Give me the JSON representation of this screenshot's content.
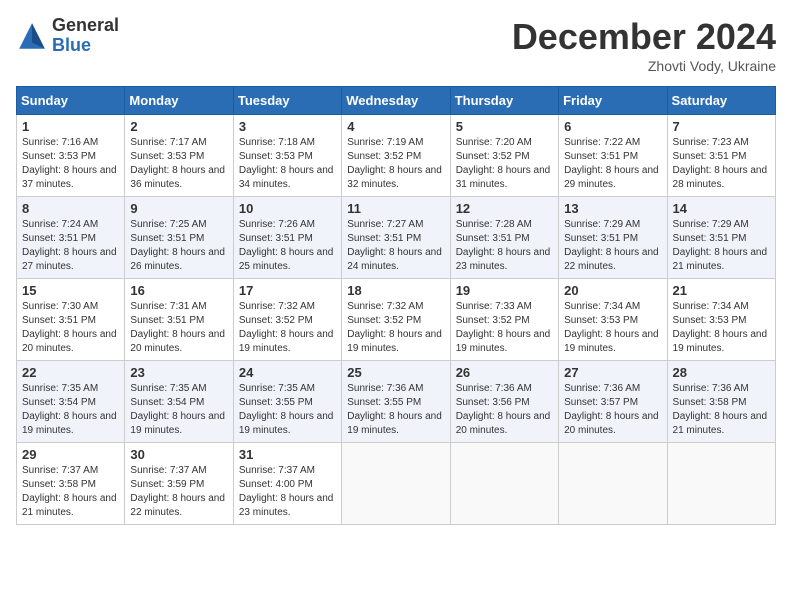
{
  "logo": {
    "general": "General",
    "blue": "Blue"
  },
  "title": "December 2024",
  "location": "Zhovti Vody, Ukraine",
  "days_of_week": [
    "Sunday",
    "Monday",
    "Tuesday",
    "Wednesday",
    "Thursday",
    "Friday",
    "Saturday"
  ],
  "weeks": [
    [
      {
        "day": "1",
        "sunrise": "7:16 AM",
        "sunset": "3:53 PM",
        "daylight": "8 hours and 37 minutes."
      },
      {
        "day": "2",
        "sunrise": "7:17 AM",
        "sunset": "3:53 PM",
        "daylight": "8 hours and 36 minutes."
      },
      {
        "day": "3",
        "sunrise": "7:18 AM",
        "sunset": "3:53 PM",
        "daylight": "8 hours and 34 minutes."
      },
      {
        "day": "4",
        "sunrise": "7:19 AM",
        "sunset": "3:52 PM",
        "daylight": "8 hours and 32 minutes."
      },
      {
        "day": "5",
        "sunrise": "7:20 AM",
        "sunset": "3:52 PM",
        "daylight": "8 hours and 31 minutes."
      },
      {
        "day": "6",
        "sunrise": "7:22 AM",
        "sunset": "3:51 PM",
        "daylight": "8 hours and 29 minutes."
      },
      {
        "day": "7",
        "sunrise": "7:23 AM",
        "sunset": "3:51 PM",
        "daylight": "8 hours and 28 minutes."
      }
    ],
    [
      {
        "day": "8",
        "sunrise": "7:24 AM",
        "sunset": "3:51 PM",
        "daylight": "8 hours and 27 minutes."
      },
      {
        "day": "9",
        "sunrise": "7:25 AM",
        "sunset": "3:51 PM",
        "daylight": "8 hours and 26 minutes."
      },
      {
        "day": "10",
        "sunrise": "7:26 AM",
        "sunset": "3:51 PM",
        "daylight": "8 hours and 25 minutes."
      },
      {
        "day": "11",
        "sunrise": "7:27 AM",
        "sunset": "3:51 PM",
        "daylight": "8 hours and 24 minutes."
      },
      {
        "day": "12",
        "sunrise": "7:28 AM",
        "sunset": "3:51 PM",
        "daylight": "8 hours and 23 minutes."
      },
      {
        "day": "13",
        "sunrise": "7:29 AM",
        "sunset": "3:51 PM",
        "daylight": "8 hours and 22 minutes."
      },
      {
        "day": "14",
        "sunrise": "7:29 AM",
        "sunset": "3:51 PM",
        "daylight": "8 hours and 21 minutes."
      }
    ],
    [
      {
        "day": "15",
        "sunrise": "7:30 AM",
        "sunset": "3:51 PM",
        "daylight": "8 hours and 20 minutes."
      },
      {
        "day": "16",
        "sunrise": "7:31 AM",
        "sunset": "3:51 PM",
        "daylight": "8 hours and 20 minutes."
      },
      {
        "day": "17",
        "sunrise": "7:32 AM",
        "sunset": "3:52 PM",
        "daylight": "8 hours and 19 minutes."
      },
      {
        "day": "18",
        "sunrise": "7:32 AM",
        "sunset": "3:52 PM",
        "daylight": "8 hours and 19 minutes."
      },
      {
        "day": "19",
        "sunrise": "7:33 AM",
        "sunset": "3:52 PM",
        "daylight": "8 hours and 19 minutes."
      },
      {
        "day": "20",
        "sunrise": "7:34 AM",
        "sunset": "3:53 PM",
        "daylight": "8 hours and 19 minutes."
      },
      {
        "day": "21",
        "sunrise": "7:34 AM",
        "sunset": "3:53 PM",
        "daylight": "8 hours and 19 minutes."
      }
    ],
    [
      {
        "day": "22",
        "sunrise": "7:35 AM",
        "sunset": "3:54 PM",
        "daylight": "8 hours and 19 minutes."
      },
      {
        "day": "23",
        "sunrise": "7:35 AM",
        "sunset": "3:54 PM",
        "daylight": "8 hours and 19 minutes."
      },
      {
        "day": "24",
        "sunrise": "7:35 AM",
        "sunset": "3:55 PM",
        "daylight": "8 hours and 19 minutes."
      },
      {
        "day": "25",
        "sunrise": "7:36 AM",
        "sunset": "3:55 PM",
        "daylight": "8 hours and 19 minutes."
      },
      {
        "day": "26",
        "sunrise": "7:36 AM",
        "sunset": "3:56 PM",
        "daylight": "8 hours and 20 minutes."
      },
      {
        "day": "27",
        "sunrise": "7:36 AM",
        "sunset": "3:57 PM",
        "daylight": "8 hours and 20 minutes."
      },
      {
        "day": "28",
        "sunrise": "7:36 AM",
        "sunset": "3:58 PM",
        "daylight": "8 hours and 21 minutes."
      }
    ],
    [
      {
        "day": "29",
        "sunrise": "7:37 AM",
        "sunset": "3:58 PM",
        "daylight": "8 hours and 21 minutes."
      },
      {
        "day": "30",
        "sunrise": "7:37 AM",
        "sunset": "3:59 PM",
        "daylight": "8 hours and 22 minutes."
      },
      {
        "day": "31",
        "sunrise": "7:37 AM",
        "sunset": "4:00 PM",
        "daylight": "8 hours and 23 minutes."
      },
      null,
      null,
      null,
      null
    ]
  ]
}
